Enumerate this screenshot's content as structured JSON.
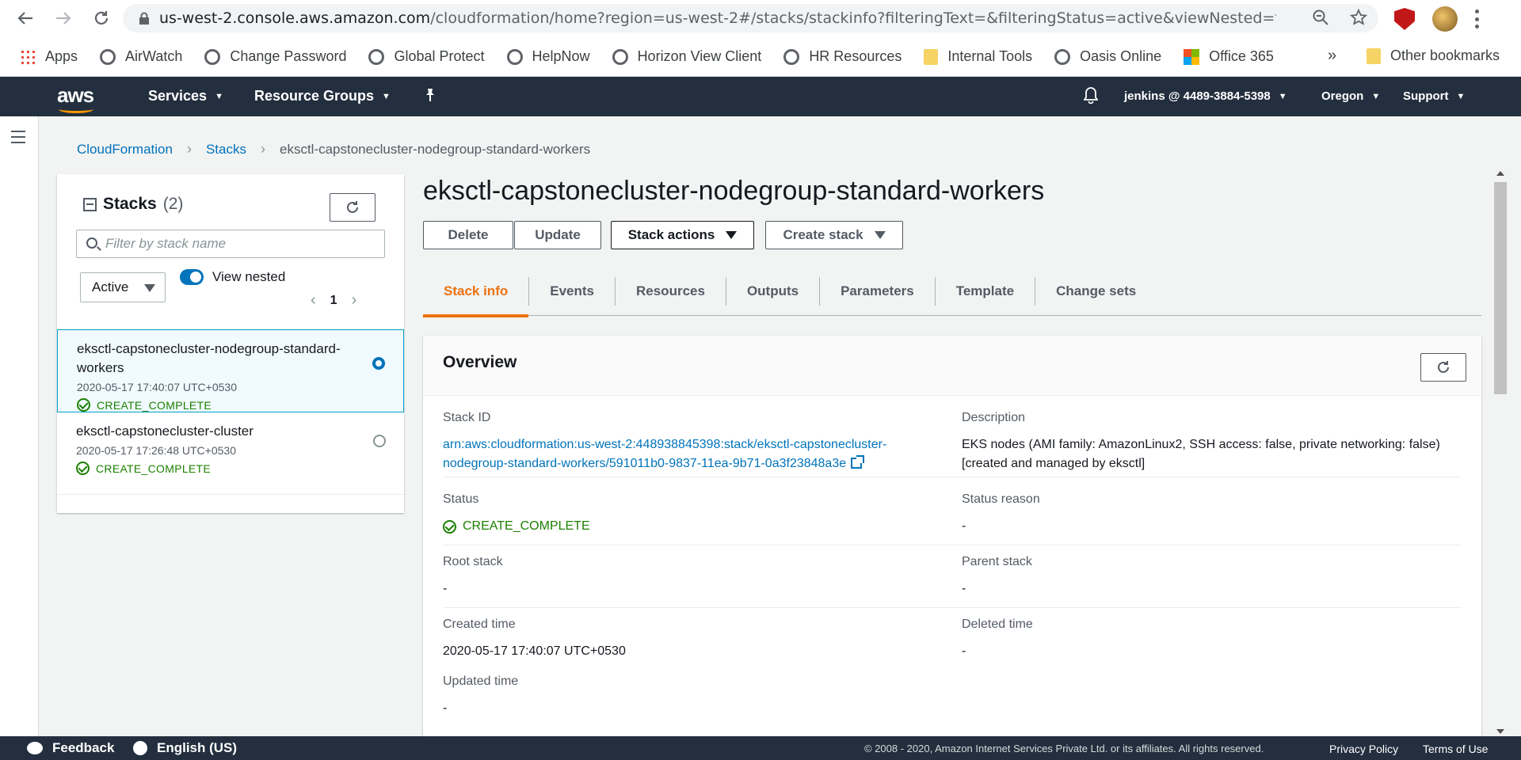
{
  "browser": {
    "url_host": "us-west-2.console.aws.amazon.com",
    "url_path": "/cloudformation/home?region=us-west-2#/stacks/stackinfo?filteringText=&filteringStatus=active&viewNested=tru...",
    "bookmarks": [
      "Apps",
      "AirWatch",
      "Change Password",
      "Global Protect",
      "HelpNow",
      "Horizon View Client",
      "HR Resources",
      "Internal Tools",
      "Oasis Online",
      "Office 365"
    ],
    "more": "»",
    "other_bookmarks": "Other bookmarks"
  },
  "aws_nav": {
    "logo": "aws",
    "services": "Services",
    "resource_groups": "Resource Groups",
    "account": "jenkins @ 4489-3884-5398",
    "region": "Oregon",
    "support": "Support"
  },
  "breadcrumb": {
    "items": [
      "CloudFormation",
      "Stacks"
    ],
    "current": "eksctl-capstonecluster-nodegroup-standard-workers"
  },
  "stacks_panel": {
    "title": "Stacks",
    "count": "(2)",
    "filter_placeholder": "Filter by stack name",
    "status_filter": "Active",
    "view_nested_label": "View nested",
    "page": "1",
    "stacks": [
      {
        "name": "eksctl-capstonecluster-nodegroup-standard-workers",
        "time": "2020-05-17 17:40:07 UTC+0530",
        "status": "CREATE_COMPLETE",
        "selected": true
      },
      {
        "name": "eksctl-capstonecluster-cluster",
        "time": "2020-05-17 17:26:48 UTC+0530",
        "status": "CREATE_COMPLETE",
        "selected": false
      }
    ]
  },
  "main": {
    "title": "eksctl-capstonecluster-nodegroup-standard-workers",
    "buttons": {
      "delete": "Delete",
      "update": "Update",
      "stack_actions": "Stack actions",
      "create_stack": "Create stack"
    },
    "tabs": [
      "Stack info",
      "Events",
      "Resources",
      "Outputs",
      "Parameters",
      "Template",
      "Change sets"
    ],
    "active_tab": "Stack info"
  },
  "overview": {
    "title": "Overview",
    "stack_id_label": "Stack ID",
    "stack_id_line1": "arn:aws:cloudformation:us-west-2:448938845398:stack/eksctl-capstonecluster-",
    "stack_id_line2": "nodegroup-standard-workers/591011b0-9837-11ea-9b71-0a3f23848a3e",
    "description_label": "Description",
    "description_line1": "EKS nodes (AMI family: AmazonLinux2, SSH access: false, private networking: false)",
    "description_line2": "[created and managed by eksctl]",
    "status_label": "Status",
    "status_value": "CREATE_COMPLETE",
    "status_reason_label": "Status reason",
    "status_reason_value": "-",
    "root_stack_label": "Root stack",
    "root_stack_value": "-",
    "parent_stack_label": "Parent stack",
    "parent_stack_value": "-",
    "created_time_label": "Created time",
    "created_time_value": "2020-05-17 17:40:07 UTC+0530",
    "deleted_time_label": "Deleted time",
    "deleted_time_value": "-",
    "updated_time_label": "Updated time",
    "updated_time_value": "-"
  },
  "footer": {
    "feedback": "Feedback",
    "language": "English (US)",
    "copyright": "© 2008 - 2020, Amazon Internet Services Private Ltd. or its affiliates. All rights reserved.",
    "privacy": "Privacy Policy",
    "terms": "Terms of Use"
  },
  "colors": {
    "aws_nav_bg": "#232f3e",
    "link": "#0073bb",
    "accent": "#ec7211",
    "success": "#1d8102"
  }
}
